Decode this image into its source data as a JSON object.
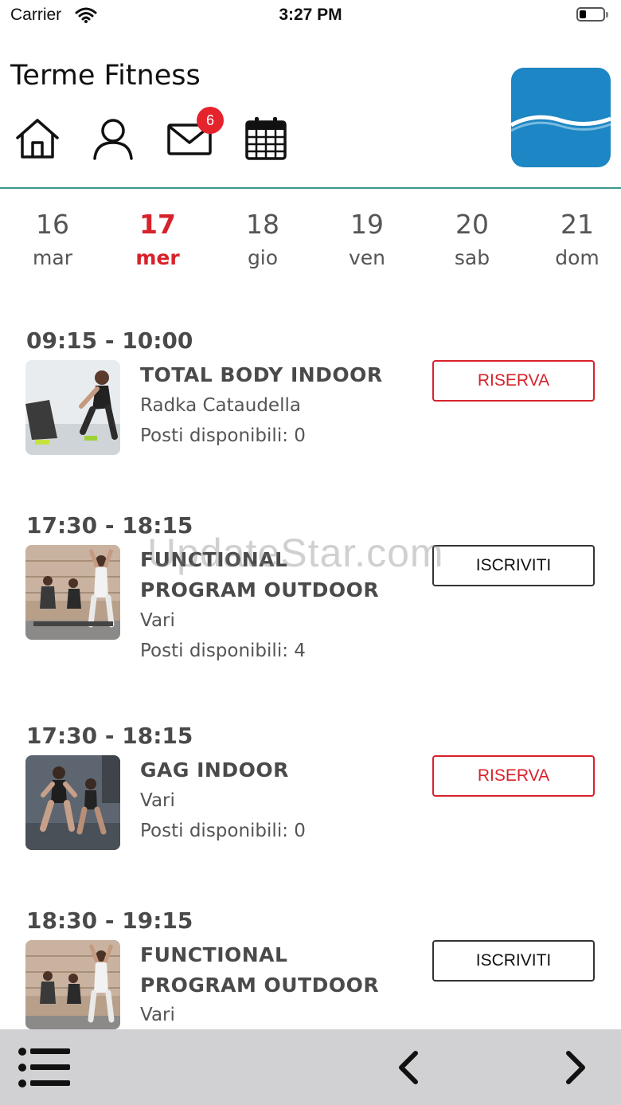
{
  "status_bar": {
    "carrier": "Carrier",
    "time": "3:27 PM"
  },
  "header": {
    "title": "Terme Fitness",
    "mail_badge": "6"
  },
  "days": [
    {
      "num": "16",
      "name": "mar"
    },
    {
      "num": "17",
      "name": "mer"
    },
    {
      "num": "18",
      "name": "gio"
    },
    {
      "num": "19",
      "name": "ven"
    },
    {
      "num": "20",
      "name": "sab"
    },
    {
      "num": "21",
      "name": "dom"
    }
  ],
  "classes": [
    {
      "time": "09:15 - 10:00",
      "title": "TOTAL BODY INDOOR",
      "instructor": "Radka Cataudella",
      "availability": "Posti disponibili: 0",
      "button": "RISERVA"
    },
    {
      "time": "17:30 - 18:15",
      "title": "FUNCTIONAL PROGRAM OUTDOOR",
      "instructor": "Vari",
      "availability": "Posti disponibili: 4",
      "button": "ISCRIVITI"
    },
    {
      "time": "17:30 - 18:15",
      "title": "GAG INDOOR",
      "instructor": "Vari",
      "availability": "Posti disponibili: 0",
      "button": "RISERVA"
    },
    {
      "time": "18:30 - 19:15",
      "title": "FUNCTIONAL PROGRAM OUTDOOR",
      "instructor": "Vari",
      "button": "ISCRIVITI"
    }
  ],
  "watermark": "UpdateStar.com",
  "colors": {
    "accent_red": "#d7222b",
    "divider_teal": "#3a9a8c",
    "logo_blue": "#1d86c4",
    "bottom_bar": "#d1d1d3"
  }
}
